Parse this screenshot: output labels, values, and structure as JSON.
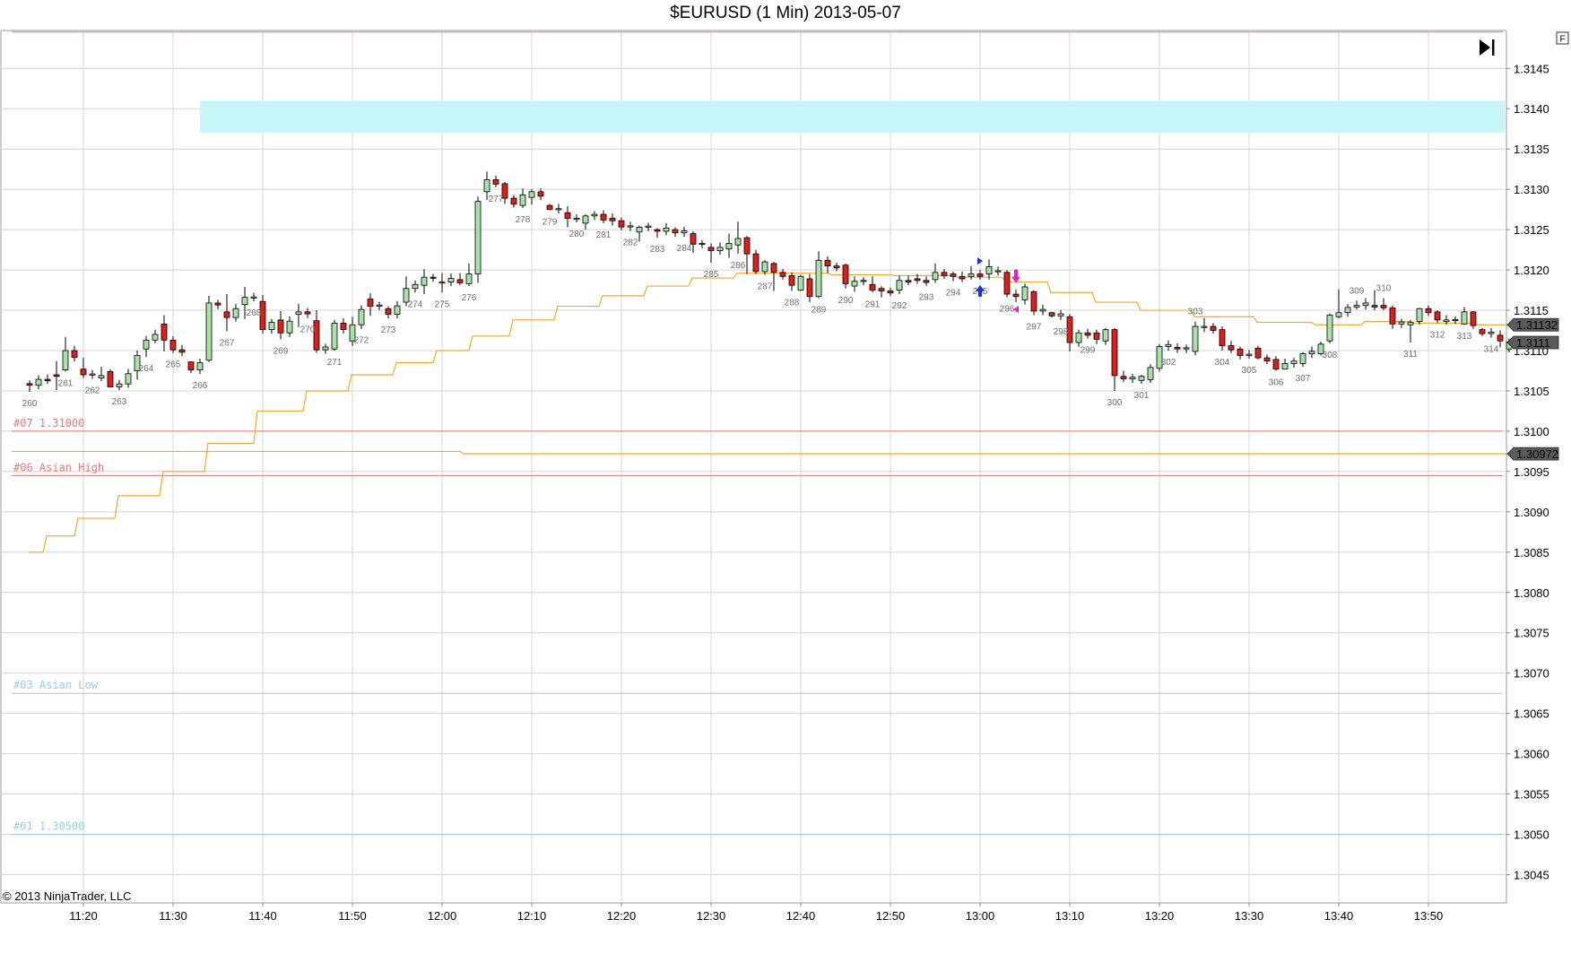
{
  "title": "$EURUSD (1 Min)  2013-05-07",
  "copyright": "© 2013 NinjaTrader, LLC",
  "corner_label": "F",
  "colors": {
    "up": "#a8e0a8",
    "down": "#d8201c",
    "grid": "#d4d4d4",
    "ma": "#f0a830",
    "zone": "#c6f6f8",
    "red_level": "#e07a7a",
    "blue_level": "#8fcfe6"
  },
  "chart_data": {
    "type": "candlestick",
    "timeframe": "1 Min",
    "x_ticks": [
      "11:20",
      "11:30",
      "11:40",
      "11:50",
      "12:00",
      "12:10",
      "12:20",
      "12:30",
      "12:40",
      "12:50",
      "13:00",
      "13:10",
      "13:20",
      "13:30",
      "13:40",
      "13:50"
    ],
    "y_ticks": [
      "1.3145",
      "1.3140",
      "1.3135",
      "1.3130",
      "1.3125",
      "1.3120",
      "1.3115",
      "1.3110",
      "1.3105",
      "1.3100",
      "1.3095",
      "1.3090",
      "1.3085",
      "1.3080",
      "1.3075",
      "1.3070",
      "1.3065",
      "1.3060",
      "1.3055",
      "1.3050",
      "1.3045"
    ],
    "ylim": [
      1.30415,
      1.31497
    ],
    "grid": true,
    "levels": [
      {
        "label": "#07 1.31000",
        "price": 1.31,
        "color": "red"
      },
      {
        "label": "#06 Asian High",
        "price": 1.30945,
        "color": "red"
      },
      {
        "label": "#03 Asian Low",
        "price": 1.30675,
        "color": "blue"
      },
      {
        "label": "#01 1.30500",
        "price": 1.305,
        "color": "blue"
      }
    ],
    "price_markers": [
      {
        "label": "1.31132",
        "price": 1.31132
      },
      {
        "label": "1.3111",
        "price": 1.3111
      },
      {
        "label": "1.30972",
        "price": 1.30972
      }
    ],
    "zone": {
      "from": 1.3137,
      "to": 1.3141,
      "start_time": "11:33"
    },
    "top_line": 1.31495,
    "first_bar_time": "11:14",
    "bar_numbers": [
      {
        "n": "260",
        "i": 0,
        "pos": "low"
      },
      {
        "n": "261",
        "i": 4,
        "pos": "low"
      },
      {
        "n": "262",
        "i": 7,
        "pos": "low"
      },
      {
        "n": "263",
        "i": 10,
        "pos": "low"
      },
      {
        "n": "264",
        "i": 13,
        "pos": "low"
      },
      {
        "n": "265",
        "i": 16,
        "pos": "low"
      },
      {
        "n": "266",
        "i": 19,
        "pos": "low"
      },
      {
        "n": "267",
        "i": 22,
        "pos": "low"
      },
      {
        "n": "268",
        "i": 25,
        "pos": "low"
      },
      {
        "n": "269",
        "i": 28,
        "pos": "low"
      },
      {
        "n": "270",
        "i": 31,
        "pos": "low"
      },
      {
        "n": "271",
        "i": 34,
        "pos": "low"
      },
      {
        "n": "272",
        "i": 37,
        "pos": "low"
      },
      {
        "n": "273",
        "i": 40,
        "pos": "low"
      },
      {
        "n": "274",
        "i": 43,
        "pos": "low"
      },
      {
        "n": "275",
        "i": 46,
        "pos": "low"
      },
      {
        "n": "276",
        "i": 49,
        "pos": "low"
      },
      {
        "n": "277",
        "i": 52,
        "pos": "low"
      },
      {
        "n": "278",
        "i": 55,
        "pos": "low"
      },
      {
        "n": "279",
        "i": 58,
        "pos": "low"
      },
      {
        "n": "280",
        "i": 61,
        "pos": "low"
      },
      {
        "n": "281",
        "i": 64,
        "pos": "low"
      },
      {
        "n": "282",
        "i": 67,
        "pos": "low"
      },
      {
        "n": "283",
        "i": 70,
        "pos": "low"
      },
      {
        "n": "284",
        "i": 73,
        "pos": "low"
      },
      {
        "n": "285",
        "i": 76,
        "pos": "low"
      },
      {
        "n": "286",
        "i": 79,
        "pos": "low"
      },
      {
        "n": "287",
        "i": 82,
        "pos": "low"
      },
      {
        "n": "288",
        "i": 85,
        "pos": "low"
      },
      {
        "n": "289",
        "i": 88,
        "pos": "low"
      },
      {
        "n": "290",
        "i": 91,
        "pos": "low"
      },
      {
        "n": "291",
        "i": 94,
        "pos": "low"
      },
      {
        "n": "292",
        "i": 97,
        "pos": "low"
      },
      {
        "n": "293",
        "i": 100,
        "pos": "low"
      },
      {
        "n": "294",
        "i": 103,
        "pos": "low"
      },
      {
        "n": "295",
        "i": 106,
        "pos": "low"
      },
      {
        "n": "296",
        "i": 109,
        "pos": "low"
      },
      {
        "n": "297",
        "i": 112,
        "pos": "low"
      },
      {
        "n": "298",
        "i": 115,
        "pos": "low"
      },
      {
        "n": "299",
        "i": 118,
        "pos": "low"
      },
      {
        "n": "300",
        "i": 121,
        "pos": "low"
      },
      {
        "n": "301",
        "i": 124,
        "pos": "low"
      },
      {
        "n": "302",
        "i": 127,
        "pos": "low"
      },
      {
        "n": "303",
        "i": 130,
        "pos": "high"
      },
      {
        "n": "304",
        "i": 133,
        "pos": "low"
      },
      {
        "n": "305",
        "i": 136,
        "pos": "low"
      },
      {
        "n": "306",
        "i": 139,
        "pos": "low"
      },
      {
        "n": "307",
        "i": 142,
        "pos": "low"
      },
      {
        "n": "308",
        "i": 145,
        "pos": "low"
      },
      {
        "n": "309",
        "i": 148,
        "pos": "high"
      },
      {
        "n": "310",
        "i": 151,
        "pos": "high"
      },
      {
        "n": "311",
        "i": 154,
        "pos": "low"
      },
      {
        "n": "312",
        "i": 157,
        "pos": "low"
      },
      {
        "n": "313",
        "i": 160,
        "pos": "low"
      },
      {
        "n": "314",
        "i": 163,
        "pos": "low"
      }
    ],
    "ohlc_anchors": [
      [
        0,
        1.31059,
        1.31057,
        1.31049,
        1.31063
      ],
      [
        3,
        1.3107,
        1.31068,
        1.31051,
        1.31087
      ],
      [
        4,
        1.31076,
        1.311,
        1.31074,
        1.31117
      ],
      [
        6,
        1.31077,
        1.3107,
        1.31066,
        1.31091
      ],
      [
        8,
        1.31066,
        1.31069,
        1.31062,
        1.3108
      ],
      [
        9,
        1.31074,
        1.31055,
        1.31054,
        1.31077
      ],
      [
        12,
        1.31075,
        1.31094,
        1.31064,
        1.311
      ],
      [
        13,
        1.31102,
        1.31113,
        1.31092,
        1.31118
      ],
      [
        15,
        1.31133,
        1.31113,
        1.31099,
        1.31144
      ],
      [
        18,
        1.31086,
        1.31076,
        1.31072,
        1.31086
      ],
      [
        20,
        1.31088,
        1.31159,
        1.31086,
        1.31168
      ],
      [
        22,
        1.31148,
        1.31141,
        1.31124,
        1.3117
      ],
      [
        24,
        1.31157,
        1.31166,
        1.31139,
        1.31179
      ],
      [
        26,
        1.31161,
        1.31126,
        1.31121,
        1.31169
      ],
      [
        28,
        1.31138,
        1.31122,
        1.31114,
        1.31149
      ],
      [
        30,
        1.31145,
        1.31148,
        1.31129,
        1.31158
      ],
      [
        32,
        1.31137,
        1.31101,
        1.31097,
        1.3115
      ],
      [
        34,
        1.31102,
        1.31134,
        1.311,
        1.31138
      ],
      [
        36,
        1.31112,
        1.31132,
        1.31106,
        1.31142
      ],
      [
        38,
        1.31164,
        1.31155,
        1.31143,
        1.31171
      ],
      [
        40,
        1.31152,
        1.31145,
        1.3114,
        1.31155
      ],
      [
        42,
        1.3116,
        1.31177,
        1.31155,
        1.31192
      ],
      [
        44,
        1.31181,
        1.31191,
        1.3117,
        1.31201
      ],
      [
        46,
        1.31184,
        1.31185,
        1.31172,
        1.31196
      ],
      [
        48,
        1.31188,
        1.31184,
        1.31181,
        1.31196
      ],
      [
        49,
        1.31183,
        1.31195,
        1.3118,
        1.31208
      ],
      [
        50,
        1.31195,
        1.31285,
        1.31184,
        1.31291
      ],
      [
        51,
        1.31297,
        1.31312,
        1.31287,
        1.31322
      ],
      [
        53,
        1.31307,
        1.31289,
        1.31282,
        1.31309
      ],
      [
        55,
        1.3128,
        1.31293,
        1.31277,
        1.31301
      ],
      [
        56,
        1.3129,
        1.31297,
        1.31281,
        1.313
      ],
      [
        58,
        1.3128,
        1.31275,
        1.31274,
        1.31282
      ],
      [
        60,
        1.31271,
        1.31264,
        1.31253,
        1.31279
      ],
      [
        62,
        1.31258,
        1.31267,
        1.3125,
        1.31269
      ],
      [
        65,
        1.31264,
        1.31261,
        1.31255,
        1.3127
      ],
      [
        68,
        1.31247,
        1.31253,
        1.31235,
        1.31255
      ],
      [
        70,
        1.3125,
        1.31248,
        1.3124,
        1.31252
      ],
      [
        72,
        1.3125,
        1.31246,
        1.31241,
        1.31253
      ],
      [
        74,
        1.31245,
        1.31232,
        1.31221,
        1.31248
      ],
      [
        76,
        1.31228,
        1.31224,
        1.31209,
        1.31233
      ],
      [
        78,
        1.31226,
        1.31233,
        1.31215,
        1.31245
      ],
      [
        79,
        1.31231,
        1.31239,
        1.3122,
        1.3126
      ],
      [
        80,
        1.3124,
        1.3122,
        1.31195,
        1.31242
      ],
      [
        81,
        1.3122,
        1.31198,
        1.31195,
        1.31225
      ],
      [
        82,
        1.31198,
        1.3121,
        1.31194,
        1.31212
      ],
      [
        83,
        1.31208,
        1.31197,
        1.31174,
        1.3121
      ],
      [
        85,
        1.31193,
        1.31181,
        1.31174,
        1.31197
      ],
      [
        86,
        1.31175,
        1.31192,
        1.31174,
        1.31194
      ],
      [
        87,
        1.31189,
        1.31167,
        1.3116,
        1.31195
      ],
      [
        88,
        1.31167,
        1.31212,
        1.31165,
        1.31223
      ],
      [
        89,
        1.31212,
        1.31205,
        1.31196,
        1.31217
      ],
      [
        91,
        1.31206,
        1.31183,
        1.31177,
        1.31208
      ],
      [
        92,
        1.3118,
        1.31186,
        1.31173,
        1.31192
      ],
      [
        94,
        1.31182,
        1.31175,
        1.31172,
        1.31192
      ],
      [
        95,
        1.31177,
        1.31174,
        1.31166,
        1.3118
      ],
      [
        97,
        1.31175,
        1.31187,
        1.3117,
        1.31193
      ],
      [
        99,
        1.31189,
        1.31187,
        1.31183,
        1.31195
      ],
      [
        101,
        1.31188,
        1.31197,
        1.31184,
        1.31208
      ],
      [
        103,
        1.31195,
        1.31192,
        1.31186,
        1.31198
      ],
      [
        105,
        1.31192,
        1.31195,
        1.31188,
        1.31205
      ],
      [
        107,
        1.31195,
        1.31204,
        1.31188,
        1.31213
      ],
      [
        108,
        1.31199,
        1.31199,
        1.31193,
        1.31204
      ],
      [
        109,
        1.31197,
        1.3117,
        1.31166,
        1.312
      ],
      [
        110,
        1.3117,
        1.31167,
        1.3116,
        1.31176
      ],
      [
        111,
        1.31163,
        1.31179,
        1.31157,
        1.31183
      ],
      [
        112,
        1.31173,
        1.31149,
        1.31144,
        1.31175
      ],
      [
        114,
        1.31147,
        1.31143,
        1.31141,
        1.31148
      ],
      [
        116,
        1.31142,
        1.3111,
        1.31099,
        1.31145
      ],
      [
        117,
        1.3111,
        1.31122,
        1.31105,
        1.31126
      ],
      [
        119,
        1.31122,
        1.31114,
        1.31108,
        1.31126
      ],
      [
        120,
        1.31112,
        1.31126,
        1.31107,
        1.31128
      ],
      [
        121,
        1.31126,
        1.31069,
        1.3105,
        1.31128
      ],
      [
        122,
        1.31068,
        1.31065,
        1.31061,
        1.31075
      ],
      [
        124,
        1.31063,
        1.31068,
        1.31059,
        1.3107
      ],
      [
        125,
        1.31064,
        1.31079,
        1.3106,
        1.31083
      ],
      [
        126,
        1.31078,
        1.31105,
        1.31074,
        1.31108
      ],
      [
        128,
        1.31104,
        1.31102,
        1.31097,
        1.31109
      ],
      [
        130,
        1.31099,
        1.3113,
        1.31094,
        1.31136
      ],
      [
        131,
        1.31129,
        1.3113,
        1.31123,
        1.3114
      ],
      [
        133,
        1.31126,
        1.31106,
        1.311,
        1.3113
      ],
      [
        135,
        1.31102,
        1.31094,
        1.31089,
        1.31105
      ],
      [
        137,
        1.31103,
        1.31091,
        1.31089,
        1.31106
      ],
      [
        139,
        1.31089,
        1.31077,
        1.31075,
        1.31093
      ],
      [
        140,
        1.31077,
        1.31084,
        1.31077,
        1.3109
      ],
      [
        142,
        1.31084,
        1.31096,
        1.3108,
        1.31098
      ],
      [
        144,
        1.31096,
        1.31108,
        1.31094,
        1.31111
      ],
      [
        145,
        1.31112,
        1.31144,
        1.31109,
        1.31146
      ],
      [
        146,
        1.31142,
        1.31147,
        1.3114,
        1.31176
      ],
      [
        148,
        1.31154,
        1.31156,
        1.31151,
        1.31162
      ],
      [
        150,
        1.31156,
        1.31154,
        1.3115,
        1.31175
      ],
      [
        151,
        1.31156,
        1.31153,
        1.3115,
        1.31165
      ],
      [
        152,
        1.31153,
        1.31133,
        1.31127,
        1.31156
      ],
      [
        154,
        1.31132,
        1.31135,
        1.3111,
        1.31138
      ],
      [
        155,
        1.31136,
        1.31152,
        1.31132,
        1.31153
      ],
      [
        157,
        1.31148,
        1.31138,
        1.31134,
        1.3115
      ],
      [
        158,
        1.31136,
        1.31138,
        1.31132,
        1.31144
      ],
      [
        160,
        1.31133,
        1.31148,
        1.31132,
        1.31154
      ],
      [
        161,
        1.31148,
        1.31131,
        1.31127,
        1.31149
      ],
      [
        162,
        1.31126,
        1.31121,
        1.31118,
        1.31128
      ],
      [
        164,
        1.31119,
        1.31112,
        1.31104,
        1.31125
      ],
      [
        165,
        1.31102,
        1.31111,
        1.31098,
        1.31115
      ]
    ],
    "ma_anchors": [
      [
        0,
        1.3085
      ],
      [
        3,
        1.3087
      ],
      [
        7,
        1.30892
      ],
      [
        12,
        1.3092
      ],
      [
        17,
        1.3095
      ],
      [
        22,
        1.30985
      ],
      [
        28,
        1.31025
      ],
      [
        33,
        1.3105
      ],
      [
        38,
        1.3107
      ],
      [
        43,
        1.31085
      ],
      [
        47,
        1.311
      ],
      [
        51,
        1.31118
      ],
      [
        56,
        1.31138
      ],
      [
        61,
        1.31155
      ],
      [
        66,
        1.31168
      ],
      [
        71,
        1.3118
      ],
      [
        76,
        1.3119
      ],
      [
        81,
        1.31196
      ],
      [
        86,
        1.31196
      ],
      [
        92,
        1.31194
      ],
      [
        100,
        1.31193
      ],
      [
        106,
        1.31191
      ],
      [
        111,
        1.31185
      ],
      [
        116,
        1.31172
      ],
      [
        121,
        1.3116
      ],
      [
        126,
        1.3115
      ],
      [
        133,
        1.31142
      ],
      [
        140,
        1.31135
      ],
      [
        146,
        1.31132
      ],
      [
        151,
        1.31136
      ],
      [
        157,
        1.31134
      ],
      [
        165,
        1.31132
      ]
    ],
    "ma_flat_line": {
      "price": 1.30972,
      "start_price": 1.30975,
      "break_index": 48
    },
    "signals": [
      {
        "i": 106,
        "type": "long-entry",
        "color": "blue"
      },
      {
        "i": 110,
        "type": "short-entry",
        "color": "magenta"
      }
    ]
  }
}
